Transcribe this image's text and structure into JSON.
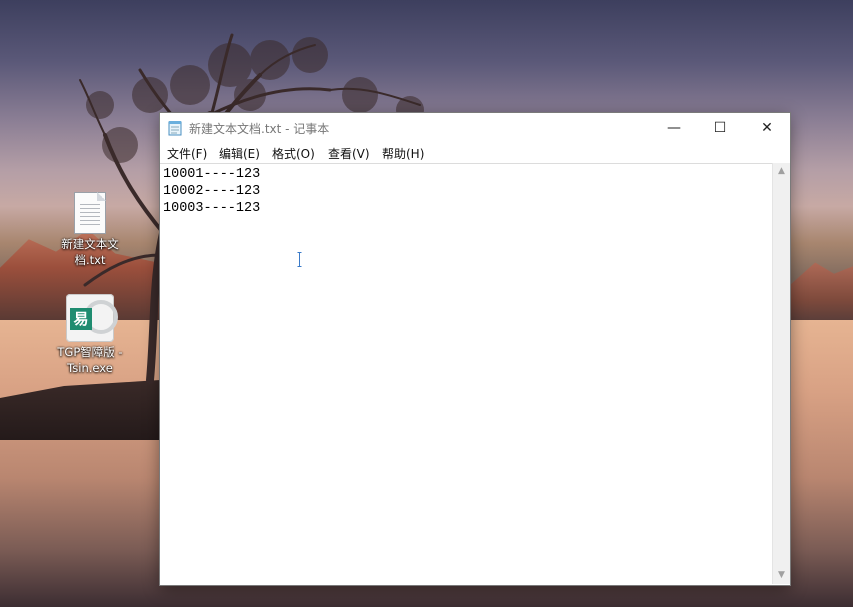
{
  "desktop": {
    "icons": [
      {
        "label_line1": "新建文本文",
        "label_line2": "档.txt"
      },
      {
        "label_line1": "TGP智障版 -",
        "label_line2": "Tsin.exe"
      }
    ]
  },
  "window": {
    "title": "新建文本文档.txt - 记事本",
    "controls": {
      "minimize": "—",
      "maximize": "☐",
      "close": "✕"
    },
    "menu": [
      "文件(F)",
      "编辑(E)",
      "格式(O)",
      "查看(V)",
      "帮助(H)"
    ],
    "content_lines": [
      "10001----123",
      "10002----123",
      "10003----123"
    ],
    "scrollbar": {
      "up": "▲",
      "down": "▼"
    }
  }
}
